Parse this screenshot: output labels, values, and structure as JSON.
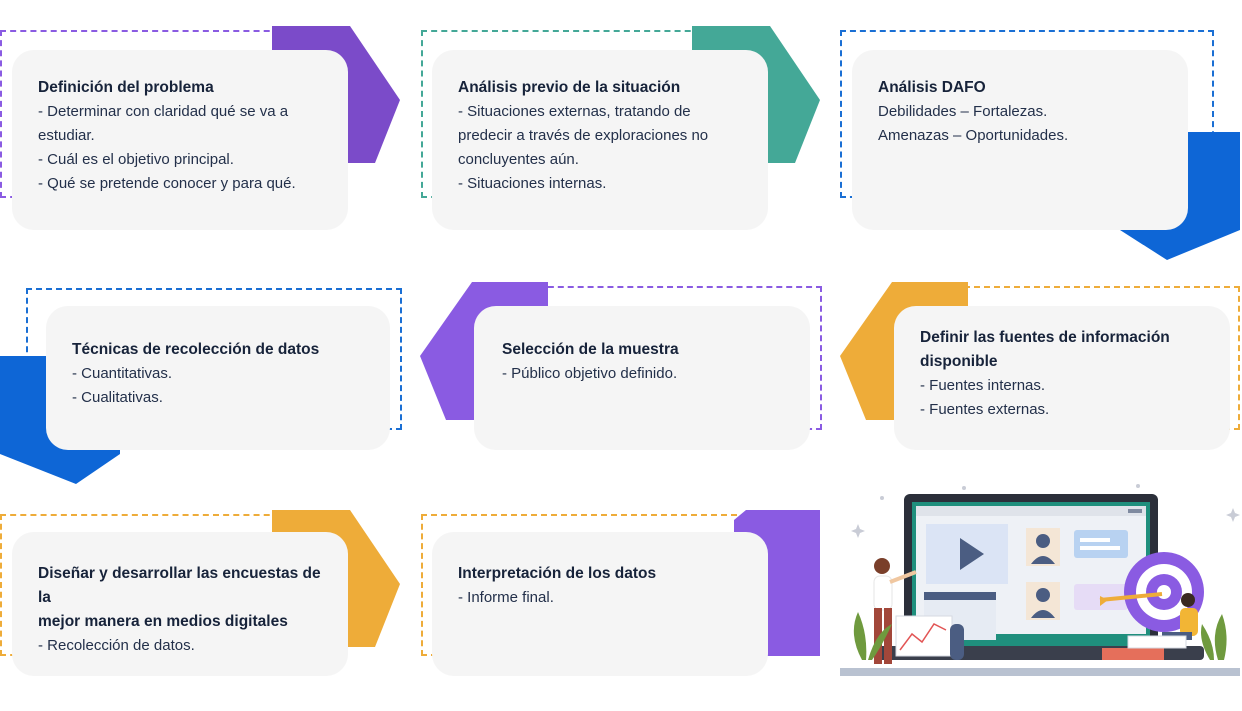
{
  "steps": [
    {
      "title": "Definición del problema",
      "lines": [
        "- Determinar con claridad qué se va a",
        "estudiar.",
        "- Cuál es el objetivo principal.",
        "- Qué se pretende conocer y para qué."
      ],
      "color": "#7b4bc9"
    },
    {
      "title": "Análisis previo de la situación",
      "lines": [
        "- Situaciones externas, tratando de",
        "predecir a través de exploraciones no",
        "concluyentes aún.",
        "- Situaciones internas."
      ],
      "color": "#44a897"
    },
    {
      "title": "Análisis DAFO",
      "lines": [
        "Debilidades – Fortalezas.",
        "Amenazas – Oportunidades."
      ],
      "color": "#0e66d6"
    },
    {
      "title": "Definir las fuentes de información disponible",
      "title_lines": [
        "Definir las fuentes de información",
        "disponible"
      ],
      "lines": [
        "- Fuentes internas.",
        "- Fuentes externas."
      ],
      "color": "#eeac39"
    },
    {
      "title": "Selección de la muestra",
      "lines": [
        "- Público objetivo definido."
      ],
      "color": "#8a5be2"
    },
    {
      "title": "Técnicas de recolección de datos",
      "lines": [
        "- Cuantitativas.",
        "- Cualitativas."
      ],
      "color": "#0e66d6"
    },
    {
      "title": "Diseñar y desarrollar las encuestas de la mejor manera en medios digitales",
      "title_lines": [
        "Diseñar y desarrollar las encuestas de la",
        "mejor manera en medios digitales"
      ],
      "lines": [
        "- Recolección de datos."
      ],
      "color": "#eeac39"
    },
    {
      "title": "Interpretación de los datos",
      "lines": [
        "- Informe final."
      ],
      "color": "#8a5be2"
    }
  ],
  "illustration": {
    "icons": [
      "presentation-screen-icon",
      "play-button-icon",
      "user-avatar-icon",
      "chat-bubble-icon",
      "target-icon",
      "arrow-icon",
      "line-chart-icon",
      "plant-icon"
    ],
    "colors": {
      "screen": "#1f8f7d",
      "target": "#8a5be2",
      "play": "#4b5d82"
    }
  }
}
